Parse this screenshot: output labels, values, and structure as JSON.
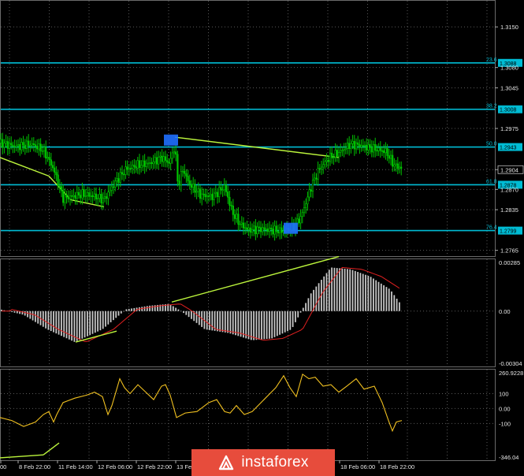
{
  "chart_data": [
    {
      "type": "candlestick",
      "panel": "price",
      "ylim": [
        1.2755,
        1.3195
      ],
      "y_ticks": [
        "1.3150",
        "1.3080",
        "1.3045",
        "1.2975",
        "1.2904",
        "1.2870",
        "1.2835",
        "1.2765"
      ],
      "current_price": "1.2904",
      "fib_levels": [
        {
          "label": "23.6",
          "value": "1.3088"
        },
        {
          "label": "38.2",
          "value": "1.3008"
        },
        {
          "label": "50.0",
          "value": "1.2943"
        },
        {
          "label": "61.8",
          "value": "1.2878"
        },
        {
          "label": "76.4",
          "value": "1.2799"
        }
      ],
      "colors": {
        "candles": "#00c400",
        "fib": "#00bcd4",
        "trend": "#bcf53c",
        "marker": "#1f6fff",
        "grid": "#5a5a5a"
      }
    },
    {
      "type": "histogram",
      "panel": "macd",
      "ylim": [
        -0.00304,
        0.00285
      ],
      "y_ticks": [
        "0.00285",
        "0.00",
        "-0.00304"
      ],
      "colors": {
        "bars": "#c8c8c8",
        "signal": "#e02020",
        "trend": "#bcf53c"
      }
    },
    {
      "type": "line",
      "panel": "cci",
      "ylim": [
        -346.04,
        260.92
      ],
      "y_ticks": [
        "260.9228",
        "100",
        "0.00",
        "-100",
        "-346.04"
      ],
      "colors": {
        "line": "#f0c020",
        "levels": "#5a5a5a",
        "trend": "#bcf53c"
      }
    }
  ],
  "x_labels": [
    "00",
    "8 Feb 22:00",
    "11 Feb 14:00",
    "12 Feb 06:00",
    "12 Feb 22:00",
    "13 Feb",
    "18 Feb 06:00",
    "18 Feb 22:00"
  ],
  "watermark": {
    "text": "instaforex",
    "color": "#e74c3c"
  }
}
